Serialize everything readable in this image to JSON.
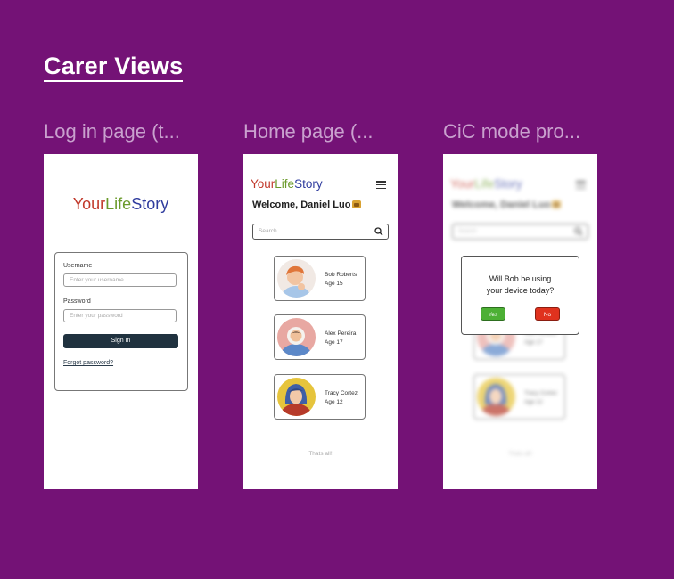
{
  "section_title": "Carer Views",
  "frames": {
    "login": {
      "label": "Log in page (t..."
    },
    "home": {
      "label": "Home page (..."
    },
    "cic": {
      "label": "CiC mode pro..."
    }
  },
  "logo": {
    "part1": "Your",
    "part2": "Life",
    "part3": "Story"
  },
  "login": {
    "username_label": "Username",
    "username_placeholder": "Enter your username",
    "password_label": "Password",
    "password_placeholder": "Enter your password",
    "signin_label": "Sign In",
    "forgot_label": "Forgot password?"
  },
  "home": {
    "welcome": "Welcome, Daniel Luo",
    "search_placeholder": "Search",
    "children": [
      {
        "name": "Bob Roberts",
        "age": "Age 15"
      },
      {
        "name": "Alex Pereira",
        "age": "Age 17"
      },
      {
        "name": "Tracy Cortez",
        "age": "Age 12"
      }
    ],
    "footer": "Thats all!"
  },
  "cic": {
    "dialog_line1": "Will Bob be using",
    "dialog_line2": "your device today?",
    "yes_label": "Yes",
    "no_label": "No"
  },
  "colors": {
    "background": "#741276",
    "logo_your": "#c1392b",
    "logo_life": "#6a9a2a",
    "logo_story": "#2f3c9e",
    "signin": "#20323f",
    "yes": "#4cb034",
    "no": "#e0321e"
  }
}
